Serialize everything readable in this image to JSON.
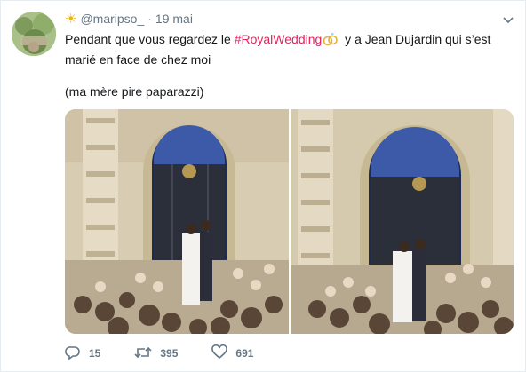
{
  "tweet": {
    "handle": "@maripso_",
    "separator": "·",
    "date": "19 mai",
    "sun_emoji": "☀",
    "text_before": "Pendant que vous regardez le ",
    "hashtag": "#RoyalWedding",
    "text_after": " y a Jean Dujardin qui s’est marié en face de chez moi",
    "text_second": "(ma mère pire paparazzi)"
  },
  "actions": {
    "reply_count": "15",
    "retweet_count": "395",
    "like_count": "691"
  },
  "colors": {
    "hashtag": "#e0245e",
    "muted": "#657786",
    "text": "#14171a",
    "border": "#e6ecf0"
  },
  "icons": {
    "reply": "reply-icon",
    "retweet": "retweet-icon",
    "like": "heart-icon",
    "menu": "chevron-down-icon"
  }
}
